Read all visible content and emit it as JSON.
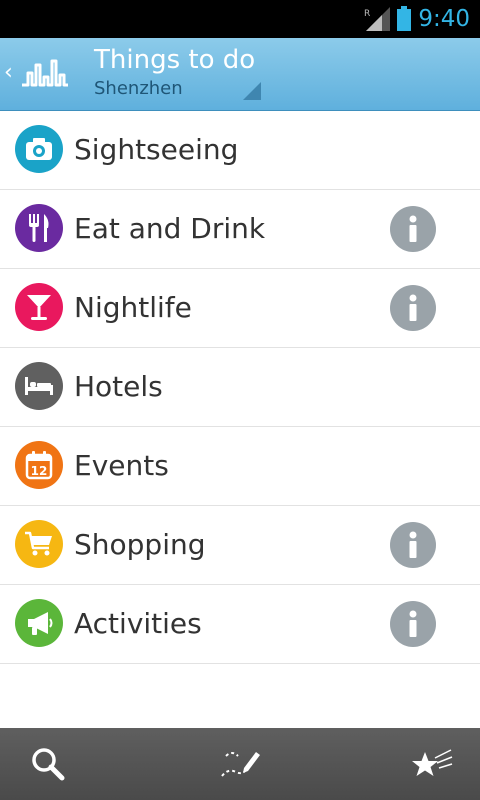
{
  "status_bar": {
    "time": "9:40",
    "network_indicator": "R",
    "signal_icon": "signal-icon",
    "battery_icon": "battery-icon"
  },
  "action_bar": {
    "title": "Things to do",
    "subtitle": "Shenzhen",
    "up_icon": "chevron-left-icon",
    "logo_icon": "city-skyline-icon"
  },
  "categories": [
    {
      "label": "Sightseeing",
      "icon": "camera-icon",
      "color": "#1aa3c8",
      "has_info": false
    },
    {
      "label": "Eat and Drink",
      "icon": "fork-knife-icon",
      "color": "#6a2aa0",
      "has_info": true
    },
    {
      "label": "Nightlife",
      "icon": "cocktail-icon",
      "color": "#e9185e",
      "has_info": true
    },
    {
      "label": "Hotels",
      "icon": "bed-icon",
      "color": "#606060",
      "has_info": false
    },
    {
      "label": "Events",
      "icon": "calendar-icon",
      "color": "#f07414",
      "calendar_day": "12",
      "has_info": false
    },
    {
      "label": "Shopping",
      "icon": "shopping-cart-icon",
      "color": "#f6b712",
      "has_info": true
    },
    {
      "label": "Activities",
      "icon": "megaphone-icon",
      "color": "#5bb63a",
      "has_info": true
    }
  ],
  "info_icon": "info-icon",
  "bottom_bar": {
    "search_icon": "search-icon",
    "edit_route_icon": "pencil-route-icon",
    "favorites_icon": "stars-icon"
  }
}
